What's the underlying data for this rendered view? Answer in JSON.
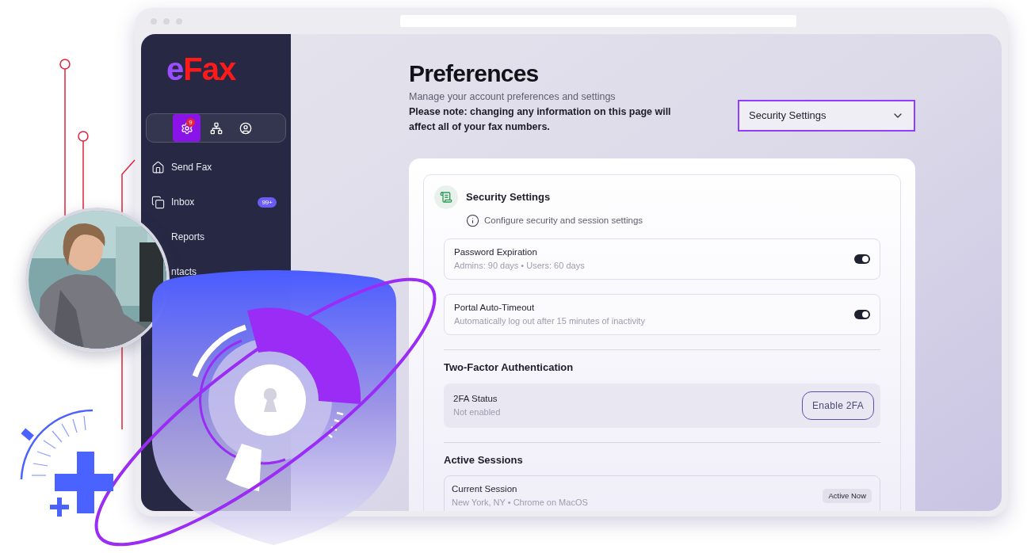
{
  "logo": {
    "prefix": "e",
    "name": "Fax"
  },
  "icon_tabs": [
    {
      "selected": true,
      "badge": "9"
    },
    {
      "selected": false
    },
    {
      "selected": false
    }
  ],
  "sidebar": {
    "items": [
      {
        "label": "Send Fax",
        "icon_visible": true
      },
      {
        "label": "Inbox",
        "badge": "99+",
        "icon_visible": true
      },
      {
        "label": "Reports",
        "icon_visible": false
      },
      {
        "label": "ntacts",
        "icon_visible": false
      }
    ]
  },
  "page": {
    "title": "Preferences",
    "subtitle": "Manage your account preferences and settings",
    "note": "Please note: changing any information on this page will affect all of your fax numbers."
  },
  "section_select": {
    "value": "Security Settings"
  },
  "panel": {
    "title": "Security Settings",
    "info": "Configure security and session settings",
    "toggles": [
      {
        "label": "Password Expiration",
        "detail": "Admins: 90 days • Users: 60 days",
        "on": true
      },
      {
        "label": "Portal Auto-Timeout",
        "detail": "Automatically log out after 15 minutes of inactivity",
        "on": true
      }
    ]
  },
  "two_factor": {
    "heading": "Two-Factor Authentication",
    "label": "2FA Status",
    "detail": "Not enabled",
    "button": "Enable 2FA"
  },
  "sessions": {
    "heading": "Active Sessions",
    "items": [
      {
        "label": "Current Session",
        "detail": "New York, NY • Chrome on MacOS",
        "badge": "Active Now"
      }
    ]
  }
}
